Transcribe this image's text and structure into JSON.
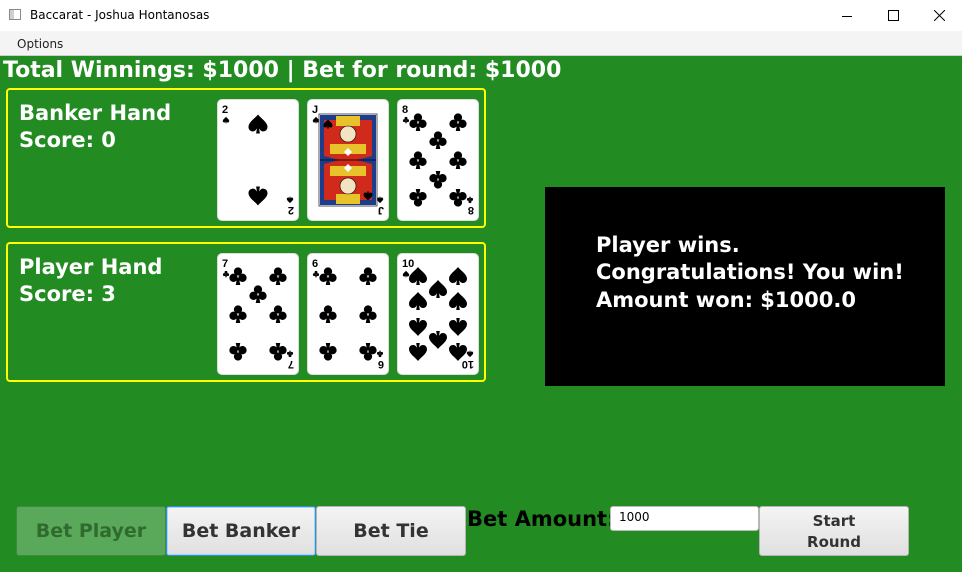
{
  "window": {
    "title": "Baccarat - Joshua Hontanosas"
  },
  "menu": {
    "items": [
      "Options"
    ]
  },
  "status": {
    "header": "Total Winnings: $1000 | Bet for round: $1000"
  },
  "banker": {
    "title": "Banker Hand",
    "score": "Score: 0",
    "cards": [
      {
        "rank": "2",
        "suit": "spades"
      },
      {
        "rank": "J",
        "suit": "spades"
      },
      {
        "rank": "8",
        "suit": "clubs"
      }
    ]
  },
  "player": {
    "title": "Player Hand",
    "score": "Score: 3",
    "cards": [
      {
        "rank": "7",
        "suit": "clubs"
      },
      {
        "rank": "6",
        "suit": "clubs"
      },
      {
        "rank": "10",
        "suit": "spades"
      }
    ]
  },
  "message": {
    "line1": "Player wins.",
    "line2": "Congratulations! You win!",
    "line3": "Amount won: $1000.0"
  },
  "controls": {
    "bet_player_label": "Bet Player",
    "bet_banker_label": "Bet Banker",
    "bet_tie_label": "Bet Tie",
    "bet_amount_label": "Bet Amount:",
    "bet_amount_value": "1000",
    "start_round_line1": "Start",
    "start_round_line2": "Round"
  },
  "colors": {
    "table_green": "#228b22",
    "panel_border": "#ffff00",
    "message_bg": "#000000"
  }
}
